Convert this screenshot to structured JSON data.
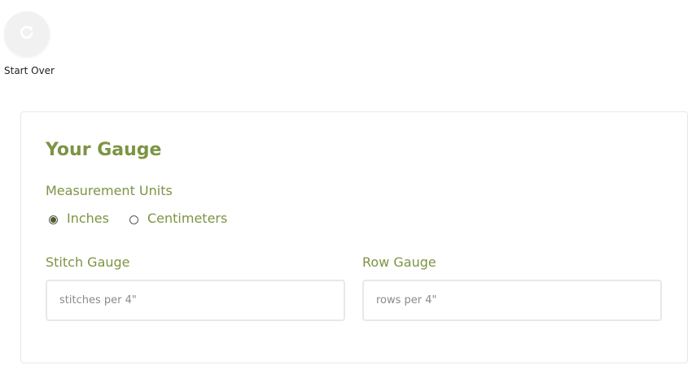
{
  "start_over": {
    "label": "Start Over",
    "icon": "refresh-icon"
  },
  "gauge_card": {
    "title": "Your Gauge",
    "units_label": "Measurement Units",
    "units_options": [
      {
        "label": "Inches",
        "selected": true
      },
      {
        "label": "Centimeters",
        "selected": false
      }
    ],
    "stitch_gauge": {
      "label": "Stitch Gauge",
      "placeholder": "stitches per 4\"",
      "value": ""
    },
    "row_gauge": {
      "label": "Row Gauge",
      "placeholder": "rows per 4\"",
      "value": ""
    }
  },
  "colors": {
    "accent": "#7d9444",
    "radio_selected": "#4a5d2a",
    "button_bg": "#f1f1f1"
  }
}
